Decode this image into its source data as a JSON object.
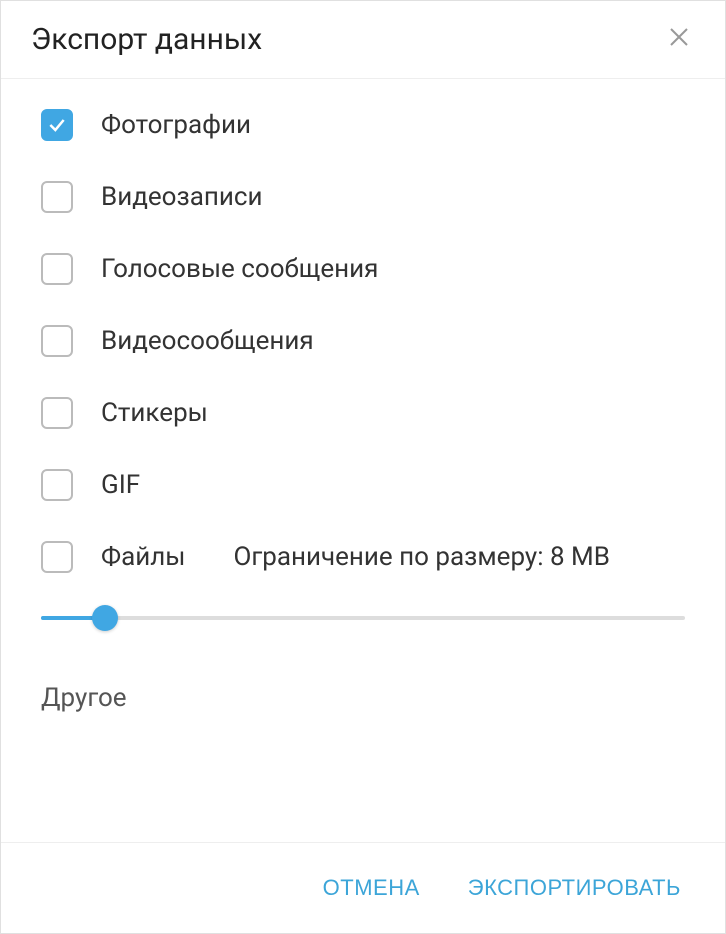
{
  "dialog": {
    "title": "Экспорт данных"
  },
  "options": {
    "photos": {
      "label": "Фотографии",
      "checked": true
    },
    "videos": {
      "label": "Видеозаписи",
      "checked": false
    },
    "voice": {
      "label": "Голосовые сообщения",
      "checked": false
    },
    "videomsg": {
      "label": "Видеосообщения",
      "checked": false
    },
    "stickers": {
      "label": "Стикеры",
      "checked": false
    },
    "gif": {
      "label": "GIF",
      "checked": false
    },
    "files": {
      "label": "Файлы",
      "checked": false
    }
  },
  "size_limit": {
    "label": "Ограничение по размеру: 8 MB",
    "value": 8,
    "unit": "MB",
    "percent": 10
  },
  "sections": {
    "other": "Другое"
  },
  "buttons": {
    "cancel": "ОТМЕНА",
    "export": "ЭКСПОРТИРОВАТЬ"
  }
}
